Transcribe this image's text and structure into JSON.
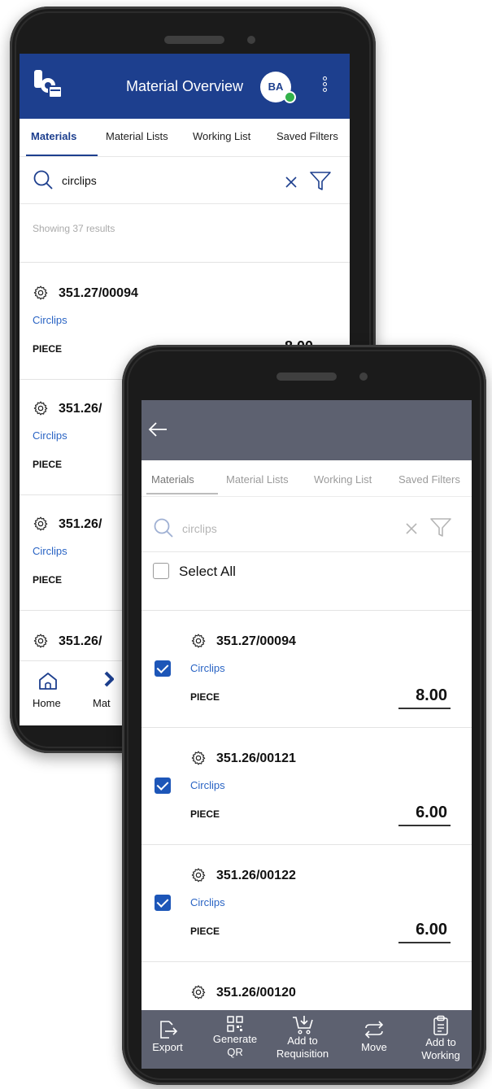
{
  "back_screen": {
    "app_title": "Material Overview",
    "avatar_initials": "BA",
    "tabs": [
      {
        "label": "Materials",
        "active": true
      },
      {
        "label": "Material Lists",
        "active": false
      },
      {
        "label": "Working List",
        "active": false
      },
      {
        "label": "Saved Filters",
        "active": false
      }
    ],
    "search": {
      "value": "circlips"
    },
    "results_text": "Showing 37 results",
    "items": [
      {
        "code": "351.27/00094",
        "description": "Circlips",
        "unit": "PIECE",
        "qty": "8.00"
      },
      {
        "code": "351.26/",
        "description": "Circlips",
        "unit": "PIECE"
      },
      {
        "code": "351.26/",
        "description": "Circlips",
        "unit": "PIECE"
      },
      {
        "code": "351.26/"
      }
    ],
    "nav": [
      {
        "label": "Home",
        "icon": "home-icon"
      },
      {
        "label": "Mat",
        "icon": "materials-icon"
      }
    ]
  },
  "front_screen": {
    "tabs": [
      {
        "label": "Materials",
        "active": true
      },
      {
        "label": "Material Lists",
        "active": false
      },
      {
        "label": "Working List",
        "active": false
      },
      {
        "label": "Saved Filters",
        "active": false
      }
    ],
    "search": {
      "value": "circlips"
    },
    "select_all_label": "Select All",
    "items": [
      {
        "code": "351.27/00094",
        "description": "Circlips",
        "unit": "PIECE",
        "qty": "8.00",
        "checked": true
      },
      {
        "code": "351.26/00121",
        "description": "Circlips",
        "unit": "PIECE",
        "qty": "6.00",
        "checked": true
      },
      {
        "code": "351.26/00122",
        "description": "Circlips",
        "unit": "PIECE",
        "qty": "6.00",
        "checked": true
      },
      {
        "code": "351.26/00120"
      }
    ],
    "actions": [
      {
        "line1": "Export",
        "line2": "",
        "icon": "export-icon"
      },
      {
        "line1": "Generate",
        "line2": "QR",
        "icon": "qr-code-icon"
      },
      {
        "line1": "Add to",
        "line2": "Requisition",
        "icon": "cart-icon"
      },
      {
        "line1": "Move",
        "line2": "",
        "icon": "move-arrows-icon"
      },
      {
        "line1": "Add to",
        "line2": "Working",
        "icon": "clipboard-icon"
      }
    ]
  },
  "colors": {
    "brand_blue": "#1d3f8e",
    "link_blue": "#2a64c4",
    "overlay_gray": "#5d6170",
    "checkbox_blue": "#1d56b8",
    "online_green": "#33b24a"
  }
}
